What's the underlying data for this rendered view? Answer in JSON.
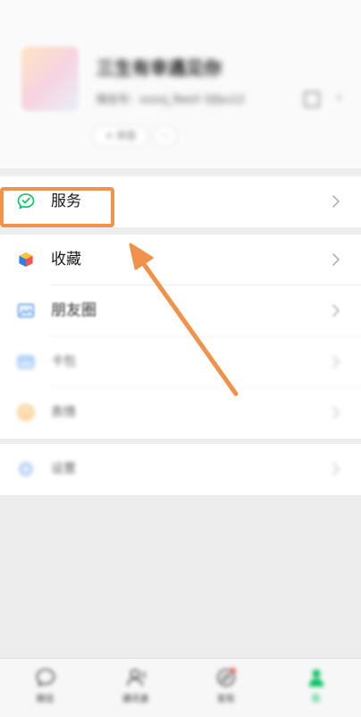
{
  "profile": {
    "name": "三生有幸遇见你",
    "wechat_id": "微信号：xxxxj_ReeX 5jfpu12",
    "status_label": "+ 状态",
    "status_more": "···"
  },
  "menu": {
    "services": {
      "label": "服务",
      "icon": "wechat-pay-icon"
    },
    "favorites": {
      "label": "收藏",
      "icon": "cube-icon"
    },
    "moments": {
      "label": "朋友圈",
      "icon": "image-icon"
    },
    "cards": {
      "label": "卡包",
      "icon": "card-icon"
    },
    "stickers": {
      "label": "表情",
      "icon": "smiley-icon"
    },
    "settings": {
      "label": "设置",
      "icon": "gear-icon"
    }
  },
  "tabbar": {
    "chats": "微信",
    "contacts": "通讯录",
    "discover": "发现",
    "me": "我"
  },
  "colors": {
    "accent": "#07c160",
    "highlight": "#f0924c",
    "background": "#ededed"
  }
}
